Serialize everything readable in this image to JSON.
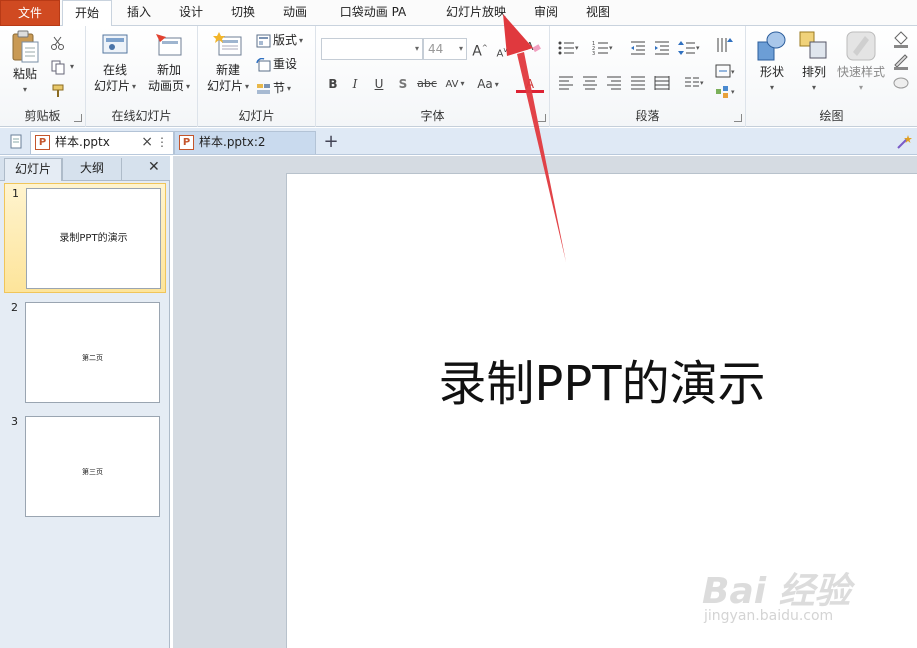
{
  "ribbon_tabs": [
    "文件",
    "开始",
    "插入",
    "设计",
    "切换",
    "动画",
    "口袋动画 PA",
    "幻灯片放映",
    "审阅",
    "视图"
  ],
  "groups": {
    "clipboard": {
      "label": "剪贴板",
      "paste": "粘贴"
    },
    "online_slides": {
      "label": "在线幻灯片",
      "online_btn": [
        "在线",
        "幻灯片"
      ],
      "newpage_btn": [
        "新加",
        "动画页"
      ]
    },
    "slides": {
      "label": "幻灯片",
      "new_slide": [
        "新建",
        "幻灯片"
      ],
      "layout": "版式",
      "reset": "重设",
      "section": "节"
    },
    "font": {
      "label": "字体",
      "font_name": "",
      "font_size": "44",
      "bold": "B",
      "italic": "I",
      "underline": "U",
      "shadow": "S",
      "strike": "abc",
      "spacing": "AV",
      "case": "Aa",
      "grow": "A",
      "shrink": "A",
      "color": "A"
    },
    "paragraph": {
      "label": "段落"
    },
    "drawing": {
      "label": "绘图",
      "shapes": "形状",
      "arrange": "排列",
      "quick_styles": "快速样式"
    }
  },
  "doc_tabs": [
    {
      "label": "样本.pptx",
      "close": "×",
      "more": "⋮"
    },
    {
      "label": "样本.pptx:2"
    }
  ],
  "new_tab": "+",
  "panel_tabs": {
    "slides": "幻灯片",
    "outline": "大纲",
    "close": "✕"
  },
  "thumbnails": [
    {
      "num": "1",
      "text": "录制PPT的演示"
    },
    {
      "num": "2",
      "text": "第二页"
    },
    {
      "num": "3",
      "text": "第三页"
    }
  ],
  "slide": {
    "title": "录制PPT的演示"
  },
  "watermark": {
    "main": "Bai 经验",
    "sub": "jingyan.baidu.com"
  },
  "colors": {
    "file_tab": "#d04a21",
    "annotation_arrow": "#e0393e",
    "selected_thumb": "#fde49a"
  }
}
